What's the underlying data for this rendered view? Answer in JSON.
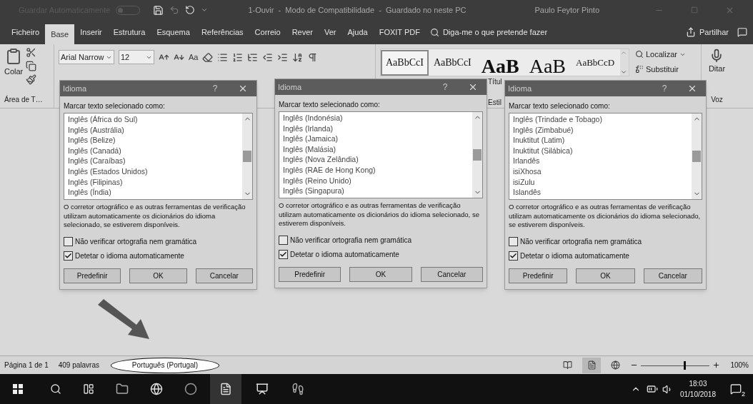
{
  "title_bar": {
    "autosave_label": "Guardar Automaticamente",
    "autosave_on": false,
    "document_title": "1-Ouvir  -  Modo de Compatibilidade  -  Guardado no neste PC",
    "user": "Paulo Feytor Pinto"
  },
  "tabs": [
    {
      "label": "Ficheiro",
      "selected": false
    },
    {
      "label": "Base",
      "selected": true
    },
    {
      "label": "Inserir",
      "selected": false
    },
    {
      "label": "Estrutura",
      "selected": false
    },
    {
      "label": "Esquema",
      "selected": false
    },
    {
      "label": "Referências",
      "selected": false
    },
    {
      "label": "Correio",
      "selected": false
    },
    {
      "label": "Rever",
      "selected": false
    },
    {
      "label": "Ver",
      "selected": false
    },
    {
      "label": "Ajuda",
      "selected": false
    },
    {
      "label": "FOXIT PDF",
      "selected": false
    }
  ],
  "tell_me": {
    "placeholder": "Diga-me o que pretende fazer"
  },
  "share": "Partilhar",
  "ribbon": {
    "paste": "Colar",
    "clipboard_group": "Área de T…",
    "font": "Arial Narrow",
    "size": "12",
    "change_case": "Aa",
    "styles": [
      {
        "label": "AaBbCcI",
        "kind": "body",
        "selected": true
      },
      {
        "label": "AaBbCcI",
        "kind": "body",
        "selected": false
      },
      {
        "label": "AaB",
        "kind": "bold-title",
        "selected": false
      },
      {
        "label": "AaB",
        "kind": "title",
        "selected": false
      },
      {
        "label": "AaBbCcD",
        "kind": "small",
        "selected": false
      }
    ],
    "style_caption": "Títul",
    "styles_group": "Estil",
    "find": "Localizar",
    "replace": "Substituir",
    "dictate": "Ditar",
    "voice_group": "Voz"
  },
  "dialogs": [
    {
      "title": "Idioma",
      "help": "?",
      "label": "Marcar texto selecionado como:",
      "items": [
        "Inglês (África do Sul)",
        "Inglês (Austrália)",
        "Inglês (Belize)",
        "Inglês (Canadá)",
        "Inglês (Caraíbas)",
        "Inglês (Estados Unidos)",
        "Inglês (Filipinas)",
        "Inglês (Índia)"
      ],
      "note": "O corretor ortográfico e as outras ferramentas de verificação utilizam automaticamente os dicionários do idioma selecionado, se estiverem disponíveis.",
      "options": [
        {
          "label": "Não verificar ortografia nem gramática",
          "checked": false
        },
        {
          "label": "Detetar o idioma automaticamente",
          "checked": true
        }
      ],
      "buttons": [
        "Predefinir",
        "OK",
        "Cancelar"
      ]
    },
    {
      "title": "Idioma",
      "help": "?",
      "label": "Marcar texto selecionado como:",
      "items": [
        "Inglês (Indonésia)",
        "Inglês (Irlanda)",
        "Inglês (Jamaica)",
        "Inglês (Malásia)",
        "Inglês (Nova Zelândia)",
        "Inglês (RAE de Hong Kong)",
        "Inglês (Reino Unido)",
        "Inglês (Singapura)"
      ],
      "note": "O corretor ortográfico e as outras ferramentas de verificação utilizam automaticamente os dicionários do idioma selecionado, se estiverem disponíveis.",
      "options": [
        {
          "label": "Não verificar ortografia nem gramática",
          "checked": false
        },
        {
          "label": "Detetar o idioma automaticamente",
          "checked": true
        }
      ],
      "buttons": [
        "Predefinir",
        "OK",
        "Cancelar"
      ]
    },
    {
      "title": "Idioma",
      "help": "?",
      "label": "Marcar texto selecionado como:",
      "items": [
        "Inglês (Trindade e Tobago)",
        "Inglês (Zimbabué)",
        "Inuktitut (Latim)",
        "Inuktitut (Silábica)",
        "Irlandês",
        "isiXhosa",
        "isiZulu",
        "Islandês"
      ],
      "note": "O corretor ortográfico e as outras ferramentas de verificação utilizam automaticamente os dicionários do idioma selecionado, se estiverem disponíveis.",
      "options": [
        {
          "label": "Não verificar ortografia nem gramática",
          "checked": false
        },
        {
          "label": "Detetar o idioma automaticamente",
          "checked": true
        }
      ],
      "buttons": [
        "Predefinir",
        "OK",
        "Cancelar"
      ]
    }
  ],
  "status_bar": {
    "page": "Página 1 de 1",
    "words": "409 palavras",
    "language_callout": "Português (Portugal)",
    "zoom_slider": {
      "level": 0.64
    },
    "zoom": "100%"
  },
  "taskbar": {
    "time": "18:03",
    "date": "01/10/2018",
    "notifications": "2"
  }
}
